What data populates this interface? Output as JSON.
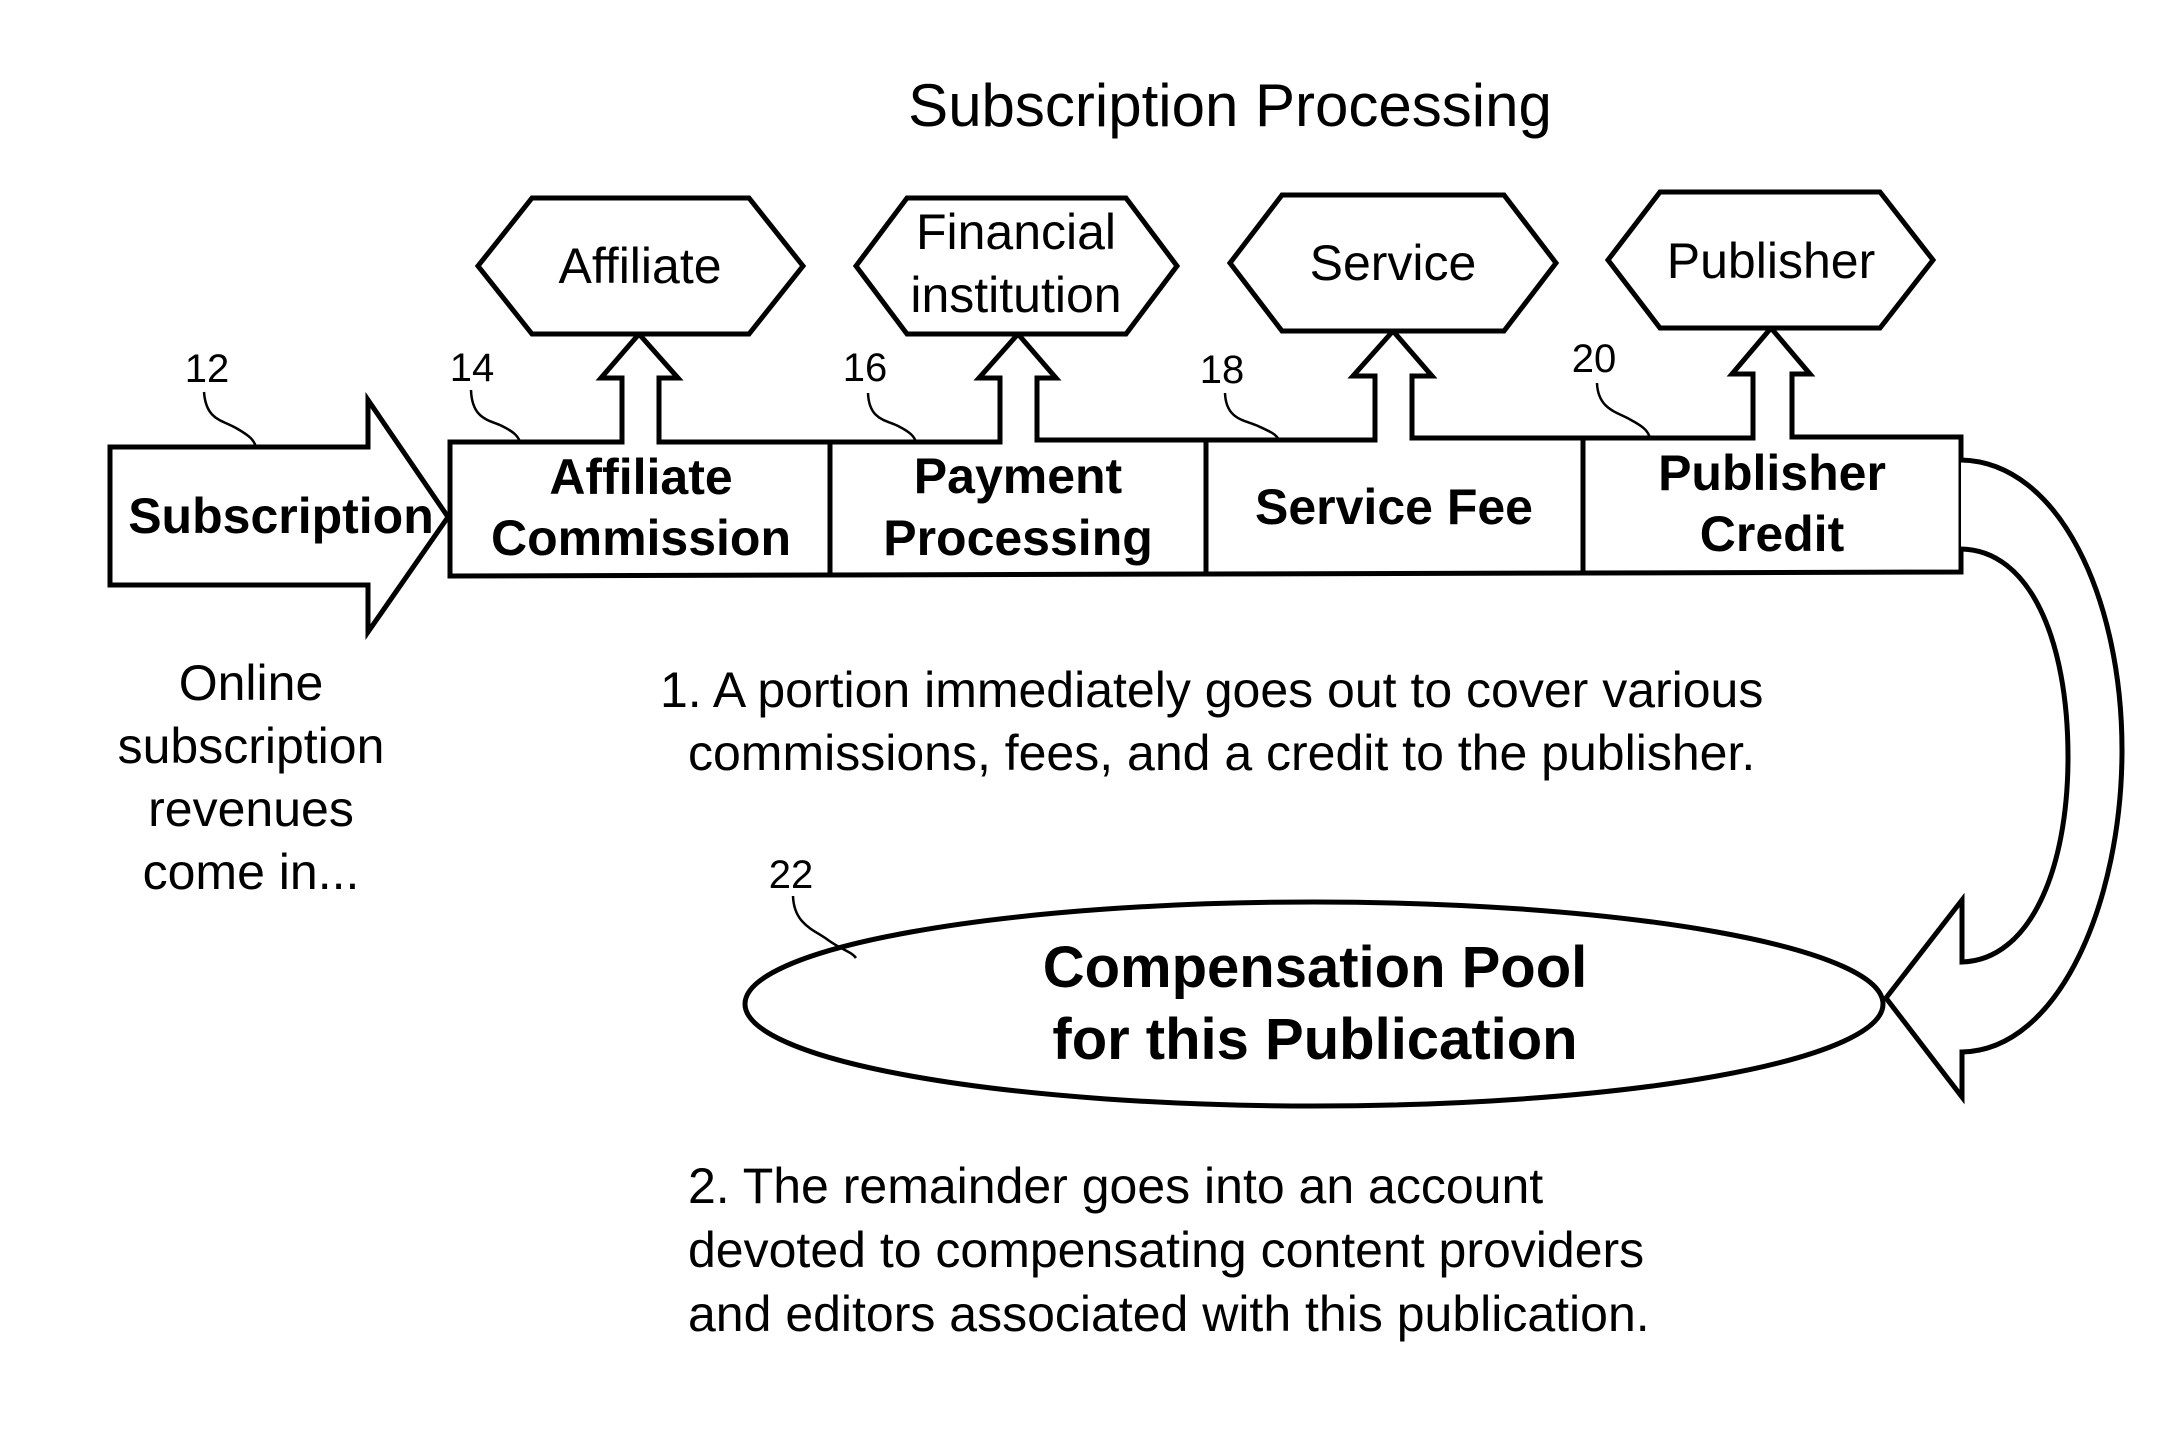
{
  "title": "Subscription Processing",
  "input": {
    "label": "Subscription",
    "ref": "12",
    "caption": [
      "Online",
      "subscription",
      "revenues",
      "come in..."
    ]
  },
  "stages": [
    {
      "ref": "14",
      "label_lines": [
        "Affiliate",
        "Commission"
      ],
      "recipient_lines": [
        "Affiliate"
      ]
    },
    {
      "ref": "16",
      "label_lines": [
        "Payment",
        "Processing"
      ],
      "recipient_lines": [
        "Financial",
        "institution"
      ]
    },
    {
      "ref": "18",
      "label_lines": [
        "Service Fee"
      ],
      "recipient_lines": [
        "Service"
      ]
    },
    {
      "ref": "20",
      "label_lines": [
        "Publisher",
        "Credit"
      ],
      "recipient_lines": [
        "Publisher"
      ]
    }
  ],
  "note1": [
    "1.  A portion immediately goes out to cover various",
    "commissions, fees, and a credit to the publisher."
  ],
  "pool": {
    "ref": "22",
    "label_lines": [
      "Compensation Pool",
      "for this Publication"
    ]
  },
  "note2": [
    "2. The remainder goes into an account",
    "devoted to compensating content providers",
    "and editors associated with this publication."
  ],
  "colors": {
    "line": "#000000",
    "background": "#ffffff"
  }
}
